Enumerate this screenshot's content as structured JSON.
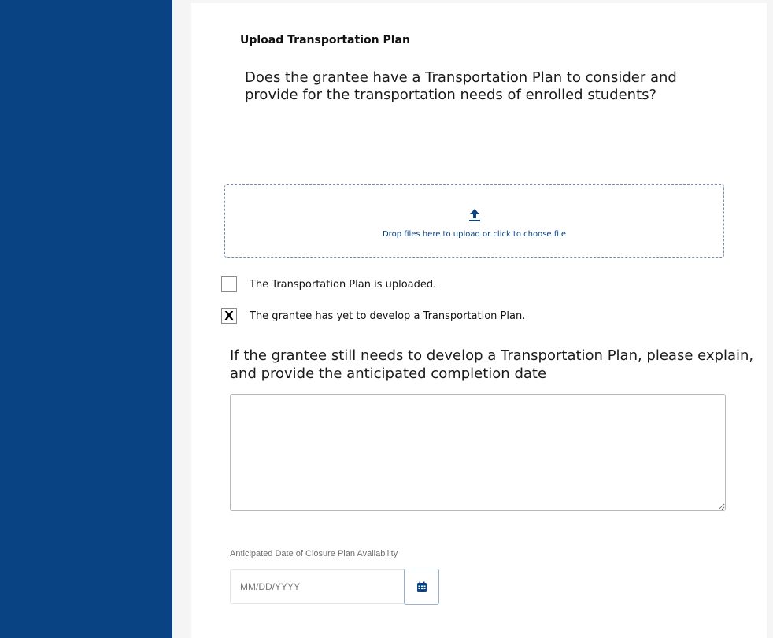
{
  "section": {
    "heading": "Upload Transportation Plan",
    "question": "Does the grantee have a Transportation Plan to consider and provide for the transportation needs of enrolled students?"
  },
  "dropzone": {
    "icon": "upload-arrow-icon",
    "text": "Drop files here to upload or click to choose file"
  },
  "checkboxes": [
    {
      "label": "The Transportation Plan is uploaded.",
      "mark": ""
    },
    {
      "label": "The grantee has yet to develop a Transportation Plan.",
      "mark": "X"
    }
  ],
  "explanation": {
    "label": "If the grantee still needs to develop a Transportation Plan, please explain, and provide the anticipated completion date",
    "value": ""
  },
  "date_field": {
    "label": "Anticipated Date of Closure Plan Availability",
    "placeholder": "MM/DD/YYYY",
    "icon": "calendar-icon"
  },
  "colors": {
    "sidebar": "#0a4384",
    "accent": "#0a4384",
    "dropzone_border": "#6d8fb8"
  }
}
